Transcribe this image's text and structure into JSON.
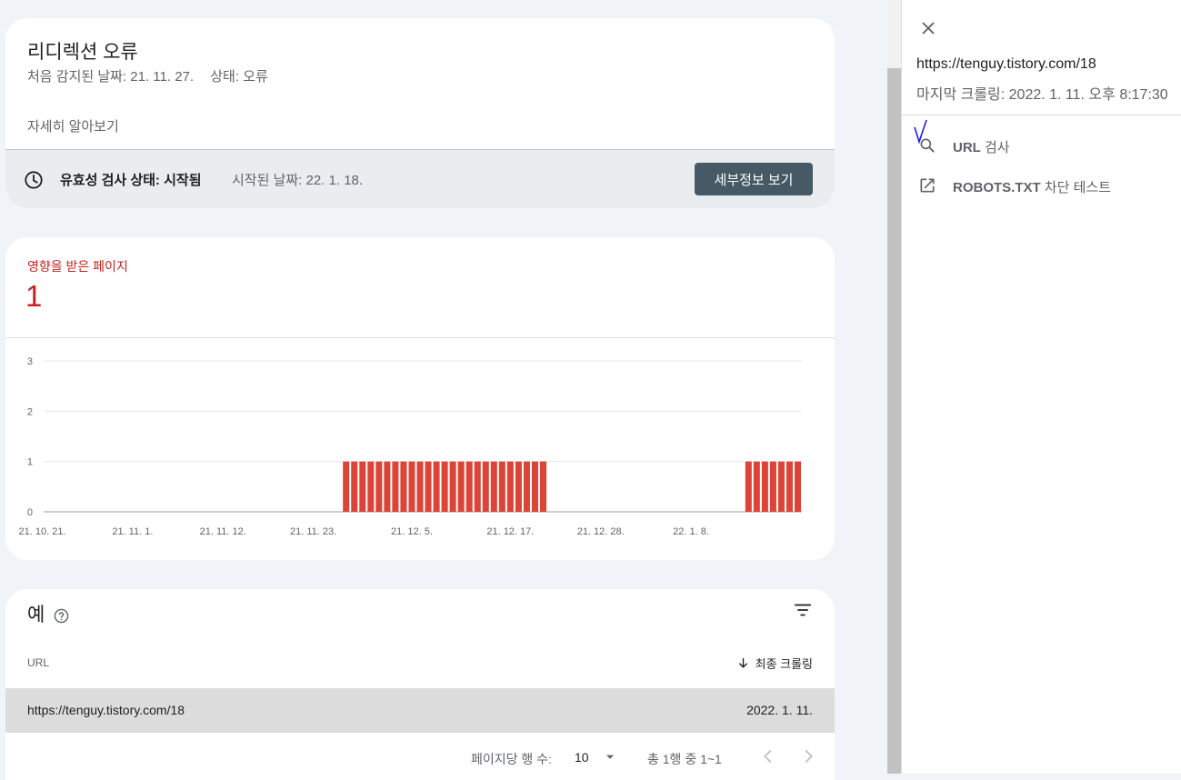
{
  "issue": {
    "title": "리디렉션 오류",
    "first_detected": "처음 감지된 날짜: 21. 11. 27.",
    "status": "상태: 오류",
    "learn_more": "자세히 알아보기",
    "validation_label": "유효성 검사 상태: 시작됨",
    "validation_started": "시작된 날짜: 22. 1. 18.",
    "details_button": "세부정보 보기"
  },
  "affected": {
    "label": "영향을 받은 페이지",
    "count": "1"
  },
  "colors": {
    "bar": "#db4437",
    "affected_text": "#c5221f",
    "button_bg": "#455a64"
  },
  "chart_data": {
    "type": "bar",
    "ylim": [
      0,
      3
    ],
    "y_ticks": [
      0,
      1,
      2,
      3
    ],
    "grid": true,
    "x_tick_labels": [
      {
        "label": "21. 10. 21.",
        "day": 0
      },
      {
        "label": "21. 11. 1.",
        "day": 11
      },
      {
        "label": "21. 11. 12.",
        "day": 22
      },
      {
        "label": "21. 11. 23.",
        "day": 33
      },
      {
        "label": "21. 12. 5.",
        "day": 45
      },
      {
        "label": "21. 12. 17.",
        "day": 57
      },
      {
        "label": "21. 12. 28.",
        "day": 68
      },
      {
        "label": "22. 1. 8.",
        "day": 79
      }
    ],
    "series": [
      {
        "values": [
          0,
          0,
          0,
          0,
          0,
          0,
          0,
          0,
          0,
          0,
          0,
          0,
          0,
          0,
          0,
          0,
          0,
          0,
          0,
          0,
          0,
          0,
          0,
          0,
          0,
          0,
          0,
          0,
          0,
          0,
          0,
          0,
          0,
          0,
          0,
          0,
          0,
          1,
          1,
          1,
          1,
          1,
          1,
          1,
          1,
          1,
          1,
          1,
          1,
          1,
          1,
          1,
          1,
          1,
          1,
          1,
          1,
          1,
          1,
          1,
          1,
          1,
          0,
          0,
          0,
          0,
          0,
          0,
          0,
          0,
          0,
          0,
          0,
          0,
          0,
          0,
          0,
          0,
          0,
          0,
          0,
          0,
          0,
          0,
          0,
          0,
          1,
          1,
          1,
          1,
          1,
          1,
          1
        ]
      }
    ]
  },
  "examples": {
    "title": "예",
    "col_url": "URL",
    "col_last_crawl": "최종 크롤링",
    "rows": [
      {
        "url": "https://tenguy.tistory.com/18",
        "last_crawl": "2022. 1. 11."
      }
    ],
    "rows_per_page_label": "페이지당 행 수:",
    "rows_per_page": "10",
    "range": "총 1행 중 1~1"
  },
  "panel": {
    "url": "https://tenguy.tistory.com/18",
    "last_crawl": "마지막 크롤링: 2022. 1. 11. 오후 8:17:30",
    "action_inspect_bold": "URL",
    "action_inspect_rest": " 검사",
    "action_robots_bold": "ROBOTS.TXT",
    "action_robots_rest": " 차단 테스트"
  },
  "icons": [
    "clock-icon",
    "help-icon",
    "filter-icon",
    "arrow-down-icon",
    "chevron-down-icon",
    "chevron-left-icon",
    "chevron-right-icon",
    "close-icon",
    "search-icon",
    "open-in-new-icon"
  ]
}
